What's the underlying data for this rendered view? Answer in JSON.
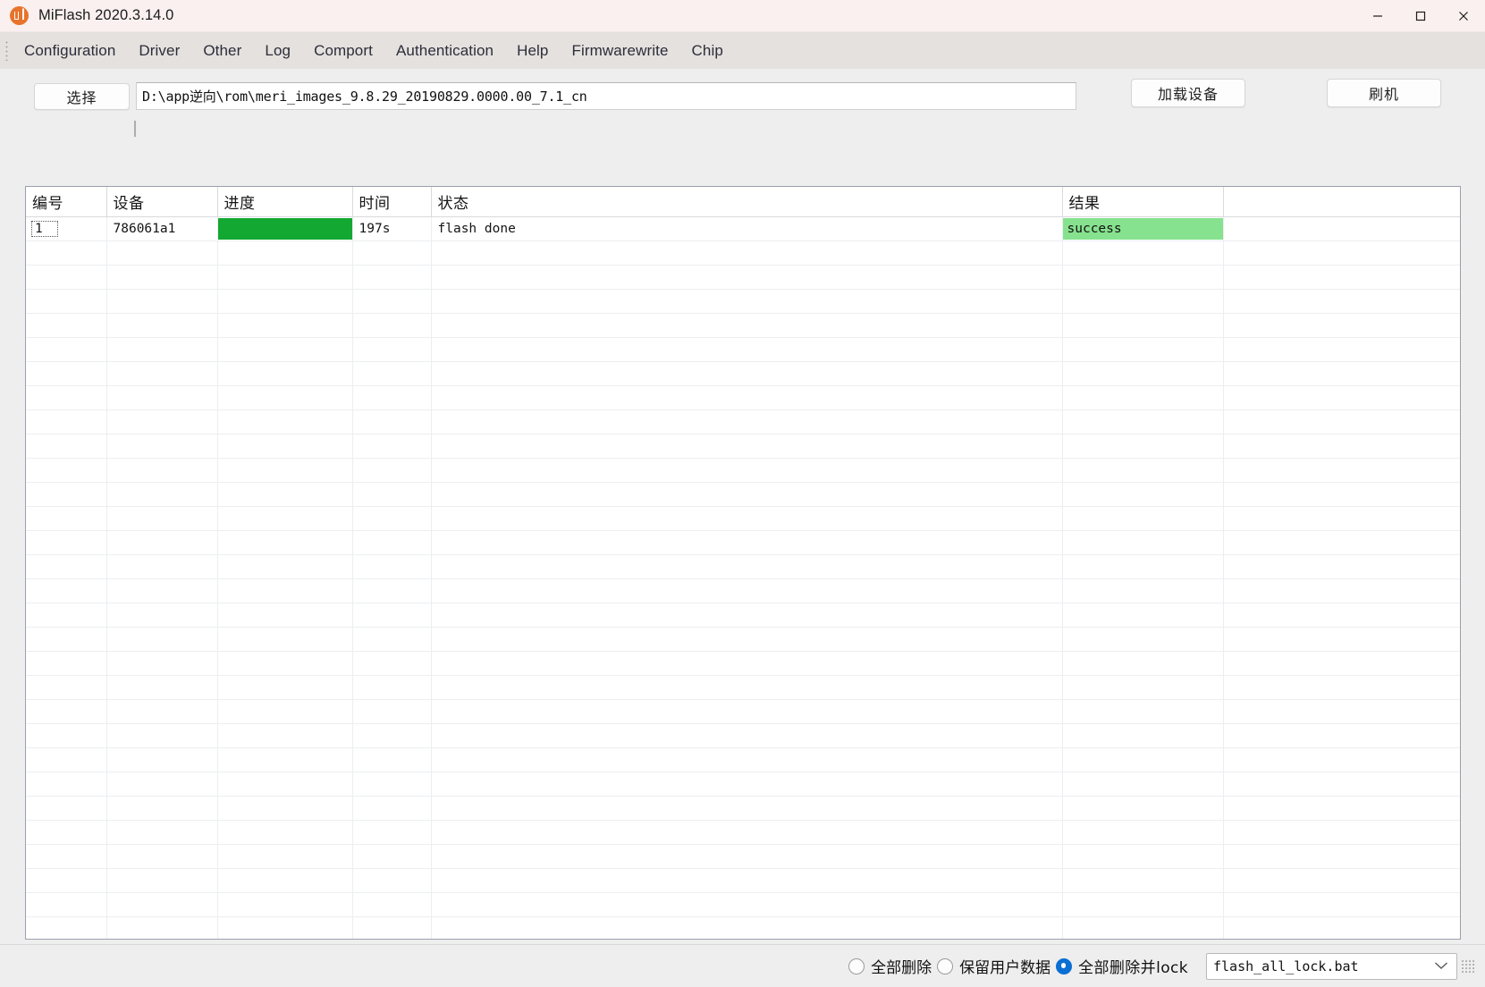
{
  "window": {
    "title": "MiFlash 2020.3.14.0",
    "icon": "mi-logo-icon",
    "controls": {
      "minimize": "minimize-icon",
      "maximize": "maximize-icon",
      "close": "close-icon"
    }
  },
  "menubar": {
    "items": [
      {
        "label": "Configuration"
      },
      {
        "label": "Driver"
      },
      {
        "label": "Other"
      },
      {
        "label": "Log"
      },
      {
        "label": "Comport"
      },
      {
        "label": "Authentication"
      },
      {
        "label": "Help"
      },
      {
        "label": "Firmwarewrite"
      },
      {
        "label": "Chip"
      }
    ]
  },
  "toolbar": {
    "select_button": "选择",
    "path_value": "D:\\app逆向\\rom\\meri_images_9.8.29_20190829.0000.00_7.1_cn",
    "path_placeholder": "",
    "load_device_button": "加载设备",
    "flash_button": "刷机"
  },
  "grid": {
    "columns": [
      {
        "key": "index",
        "label": "编号"
      },
      {
        "key": "device",
        "label": "设备"
      },
      {
        "key": "progress",
        "label": "进度"
      },
      {
        "key": "time",
        "label": "时间"
      },
      {
        "key": "status",
        "label": "状态"
      },
      {
        "key": "result",
        "label": "结果"
      },
      {
        "key": "spare",
        "label": ""
      }
    ],
    "rows": [
      {
        "index": "1",
        "device": "786061a1",
        "progress": 100,
        "time": "197s",
        "status": "flash done",
        "result": "success"
      }
    ],
    "empty_row_count": 30,
    "colors": {
      "progress_fill": "#12a832",
      "result_success_bg": "#86e28e"
    }
  },
  "bottombar": {
    "radios": [
      {
        "label": "全部删除",
        "checked": false
      },
      {
        "label": "保留用户数据",
        "checked": false
      },
      {
        "label": "全部删除并lock",
        "checked": true
      }
    ],
    "script_select": {
      "value": "flash_all_lock.bat",
      "options": [
        "flash_all_lock.bat"
      ]
    }
  }
}
